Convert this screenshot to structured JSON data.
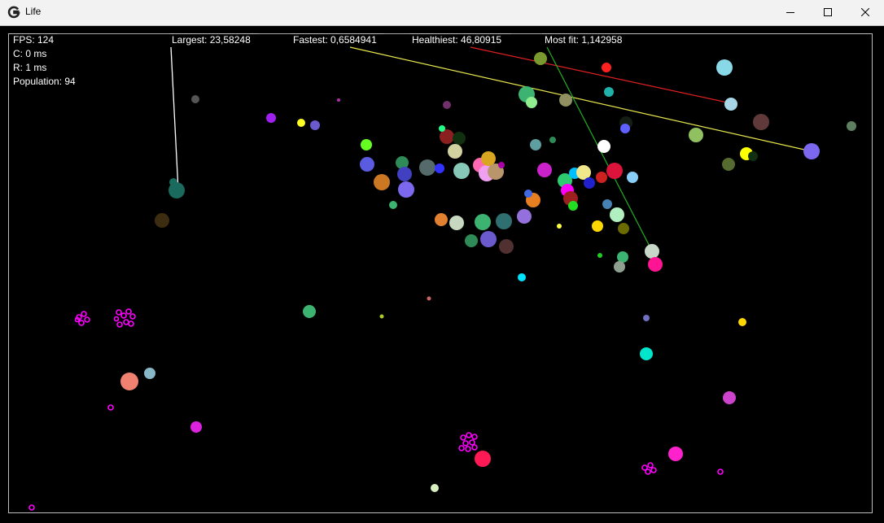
{
  "window": {
    "title": "Life",
    "icon": "app-logo-icon",
    "controls": [
      "minimize-icon",
      "maximize-icon",
      "close-icon"
    ]
  },
  "stats": {
    "fps": "FPS: 124",
    "compute": "C: 0 ms",
    "render": "R: 1 ms",
    "population": "Population: 94"
  },
  "records": {
    "largest": "Largest: 23,58248",
    "fastest": "Fastest: 0,6584941",
    "healthiest": "Healthiest: 46,80915",
    "most_fit": "Most fit: 1,142958"
  },
  "colors": {
    "background": "#000000",
    "largest_marker": "#ffffff",
    "fastest_marker": "#ffff66",
    "healthiest_marker": "#ff2020",
    "most_fit_marker": "#22cc22"
  }
}
